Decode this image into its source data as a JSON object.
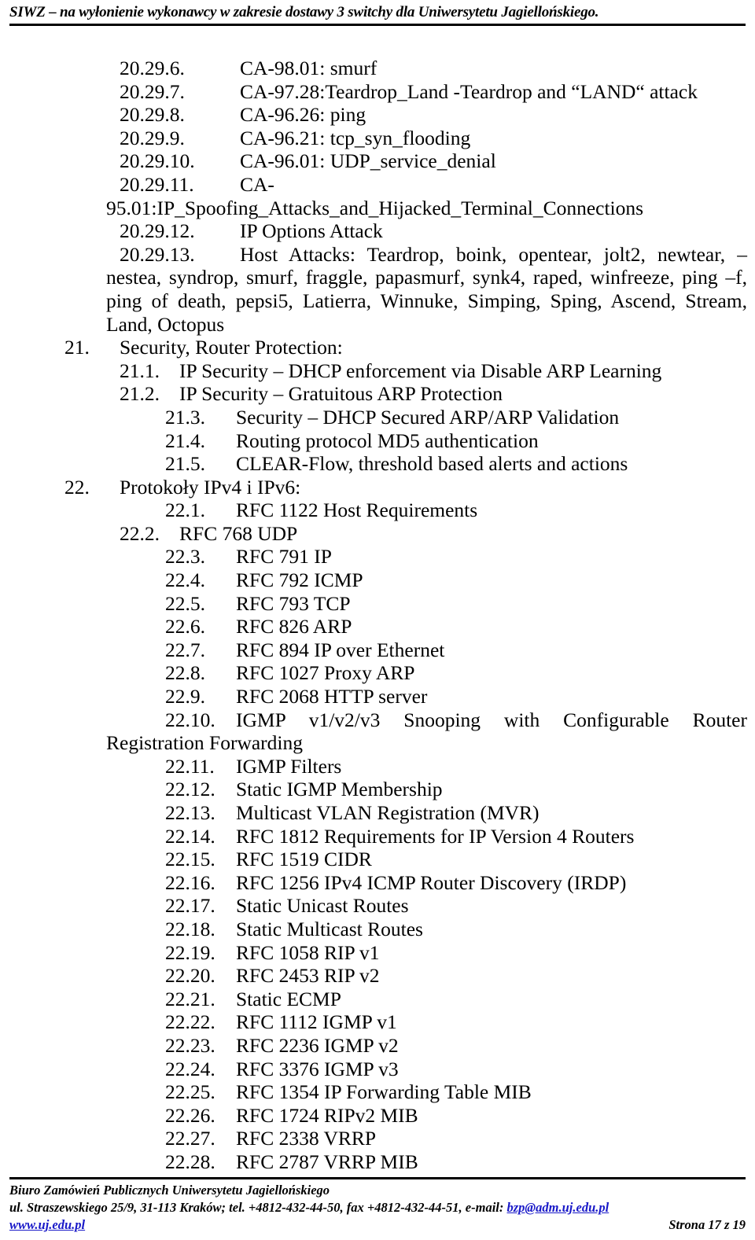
{
  "header": {
    "title": "SIWZ – na wyłonienie wykonawcy w zakresie dostawy 3 switchy dla Uniwersytetu Jagiellońskiego."
  },
  "content": {
    "entries_2029": [
      {
        "num": "20.29.6.",
        "text": "CA-98.01: smurf"
      },
      {
        "num": "20.29.7.",
        "text": "CA-97.28:Teardrop_Land -Teardrop and “LAND“ attack"
      },
      {
        "num": "20.29.8.",
        "text": "CA-96.26: ping"
      },
      {
        "num": "20.29.9.",
        "text": "CA-96.21: tcp_syn_flooding"
      },
      {
        "num": "20.29.10.",
        "text": "CA-96.01: UDP_service_denial"
      },
      {
        "num": "20.29.11.",
        "text": "CA-"
      }
    ],
    "spoofing_continuation": "95.01:IP_Spoofing_Attacks_and_Hijacked_Terminal_Connections",
    "entry_2029_12": {
      "num": "20.29.12.",
      "text": "IP Options Attack"
    },
    "entry_2029_13": {
      "num": "20.29.13.",
      "text": "Host Attacks: Teardrop, boink, opentear, jolt2, newtear, – nestea, syndrop, smurf, fraggle, papasmurf, synk4, raped, winfreeze, ping –f, ping of death, pepsi5, Latierra, Winnuke, Simping, Sping, Ascend, Stream, Land, Octopus"
    },
    "section_21": {
      "num": "21.",
      "title": "Security, Router Protection:",
      "items": [
        {
          "num": "21.1.",
          "text": "IP Security – DHCP enforcement via Disable ARP Learning",
          "level": "b"
        },
        {
          "num": "21.2.",
          "text": "IP Security – Gratuitous ARP Protection",
          "level": "b"
        },
        {
          "num": "21.3.",
          "text": "Security – DHCP Secured ARP/ARP Validation",
          "level": "c"
        },
        {
          "num": "21.4.",
          "text": "Routing protocol MD5 authentication",
          "level": "c"
        },
        {
          "num": "21.5.",
          "text": "CLEAR-Flow, threshold based alerts and actions",
          "level": "c"
        }
      ]
    },
    "section_22": {
      "num": "22.",
      "title": "Protokoły IPv4 i IPv6:",
      "items_before_wrap": [
        {
          "num": "22.1.",
          "text": "RFC 1122 Host Requirements",
          "level": "c"
        },
        {
          "num": "22.2.",
          "text": "RFC 768 UDP",
          "level": "b"
        },
        {
          "num": "22.3.",
          "text": "RFC 791 IP",
          "level": "c"
        },
        {
          "num": "22.4.",
          "text": "RFC 792 ICMP",
          "level": "c"
        },
        {
          "num": "22.5.",
          "text": "RFC 793 TCP",
          "level": "c"
        },
        {
          "num": "22.6.",
          "text": "RFC 826 ARP",
          "level": "c"
        },
        {
          "num": "22.7.",
          "text": "RFC 894 IP over Ethernet",
          "level": "c"
        },
        {
          "num": "22.8.",
          "text": "RFC 1027 Proxy ARP",
          "level": "c"
        },
        {
          "num": "22.9.",
          "text": "RFC 2068 HTTP server",
          "level": "c"
        }
      ],
      "item_2210": {
        "num": "22.10.",
        "text": "IGMP v1/v2/v3 Snooping with Configurable Router Registration Forwarding"
      },
      "items_after_wrap": [
        {
          "num": "22.11.",
          "text": "IGMP Filters",
          "level": "c"
        },
        {
          "num": "22.12.",
          "text": "Static IGMP Membership",
          "level": "c"
        },
        {
          "num": "22.13.",
          "text": "Multicast VLAN Registration (MVR)",
          "level": "c"
        },
        {
          "num": "22.14.",
          "text": "RFC 1812 Requirements for IP Version 4 Routers",
          "level": "c"
        },
        {
          "num": "22.15.",
          "text": "RFC 1519 CIDR",
          "level": "c"
        },
        {
          "num": "22.16.",
          "text": "RFC 1256 IPv4 ICMP Router Discovery (IRDP)",
          "level": "c"
        },
        {
          "num": "22.17.",
          "text": "Static Unicast Routes",
          "level": "c"
        },
        {
          "num": "22.18.",
          "text": "Static Multicast Routes",
          "level": "c"
        },
        {
          "num": "22.19.",
          "text": "RFC 1058 RIP v1",
          "level": "c"
        },
        {
          "num": "22.20.",
          "text": "RFC 2453 RIP v2",
          "level": "c"
        },
        {
          "num": "22.21.",
          "text": "Static ECMP",
          "level": "c"
        },
        {
          "num": "22.22.",
          "text": "RFC 1112 IGMP v1",
          "level": "c"
        },
        {
          "num": "22.23.",
          "text": "RFC 2236 IGMP v2",
          "level": "c"
        },
        {
          "num": "22.24.",
          "text": "RFC 3376 IGMP v3",
          "level": "c"
        },
        {
          "num": "22.25.",
          "text": "RFC 1354 IP Forwarding Table MIB",
          "level": "c"
        },
        {
          "num": "22.26.",
          "text": "RFC 1724 RIPv2 MIB",
          "level": "c"
        },
        {
          "num": "22.27.",
          "text": " RFC 2338 VRRP",
          "level": "c"
        },
        {
          "num": "22.28.",
          "text": "RFC 2787 VRRP MIB",
          "level": "c"
        }
      ]
    }
  },
  "footer": {
    "org": "Biuro Zamówień Publicznych Uniwersytetu Jagiellońskiego",
    "address_prefix": "ul. Straszewskiego 25/9, 31-113 Kraków; tel. +4812-432-44-50, fax +4812-432-44-51, e-mail: ",
    "email": "bzp@adm.uj.edu.pl",
    "website": "www.uj.edu.pl",
    "page_number": "Strona 17 z 19"
  }
}
